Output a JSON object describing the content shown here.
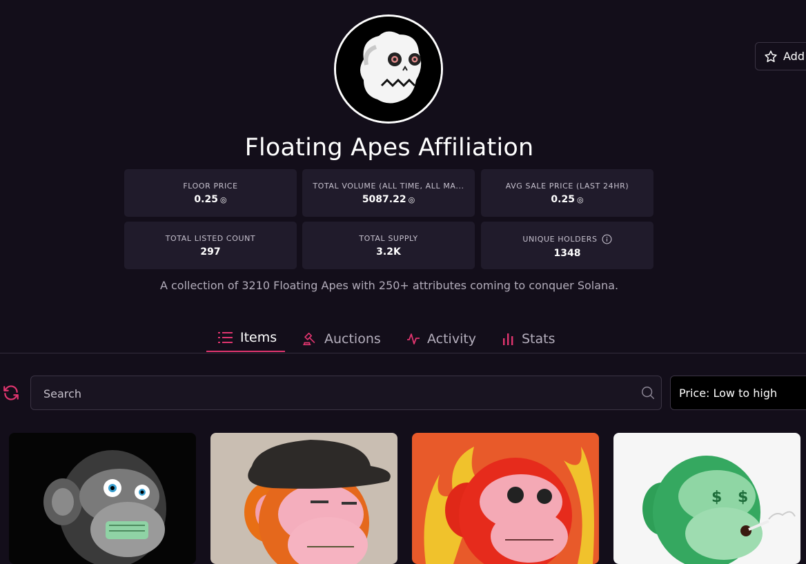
{
  "collection": {
    "name": "Floating Apes Affiliation",
    "description": "A collection of 3210 Floating Apes with 250+ attributes coming to conquer Solana.",
    "watchlist_label": "Add"
  },
  "stats": [
    {
      "label": "FLOOR PRICE",
      "value": "0.25",
      "currency_icon": "solana-icon"
    },
    {
      "label": "TOTAL VOLUME (ALL TIME, ALL MA...",
      "value": "5087.22",
      "currency_icon": "solana-icon"
    },
    {
      "label": "AVG SALE PRICE (LAST 24HR)",
      "value": "0.25",
      "currency_icon": "solana-icon"
    },
    {
      "label": "TOTAL LISTED COUNT",
      "value": "297"
    },
    {
      "label": "TOTAL SUPPLY",
      "value": "3.2K"
    },
    {
      "label": "UNIQUE HOLDERS",
      "value": "1348",
      "info_icon": "info-icon"
    }
  ],
  "tabs": [
    {
      "label": "Items",
      "icon": "list-icon",
      "active": true
    },
    {
      "label": "Auctions",
      "icon": "gavel-icon",
      "active": false
    },
    {
      "label": "Activity",
      "icon": "activity-icon",
      "active": false
    },
    {
      "label": "Stats",
      "icon": "bar-chart-icon",
      "active": false
    }
  ],
  "search": {
    "placeholder": "Search"
  },
  "sort": {
    "selected": "Price: Low to high"
  },
  "colors": {
    "background": "#130e1a",
    "card": "#201b2b",
    "accent": "#e1356f"
  },
  "items": [
    {
      "art": "grey-ape-with-cash-mouth"
    },
    {
      "art": "pink-ape-with-bucket-hat"
    },
    {
      "art": "red-ape-on-fire-background"
    },
    {
      "art": "green-ape-with-dollar-eyes-smoking"
    }
  ]
}
